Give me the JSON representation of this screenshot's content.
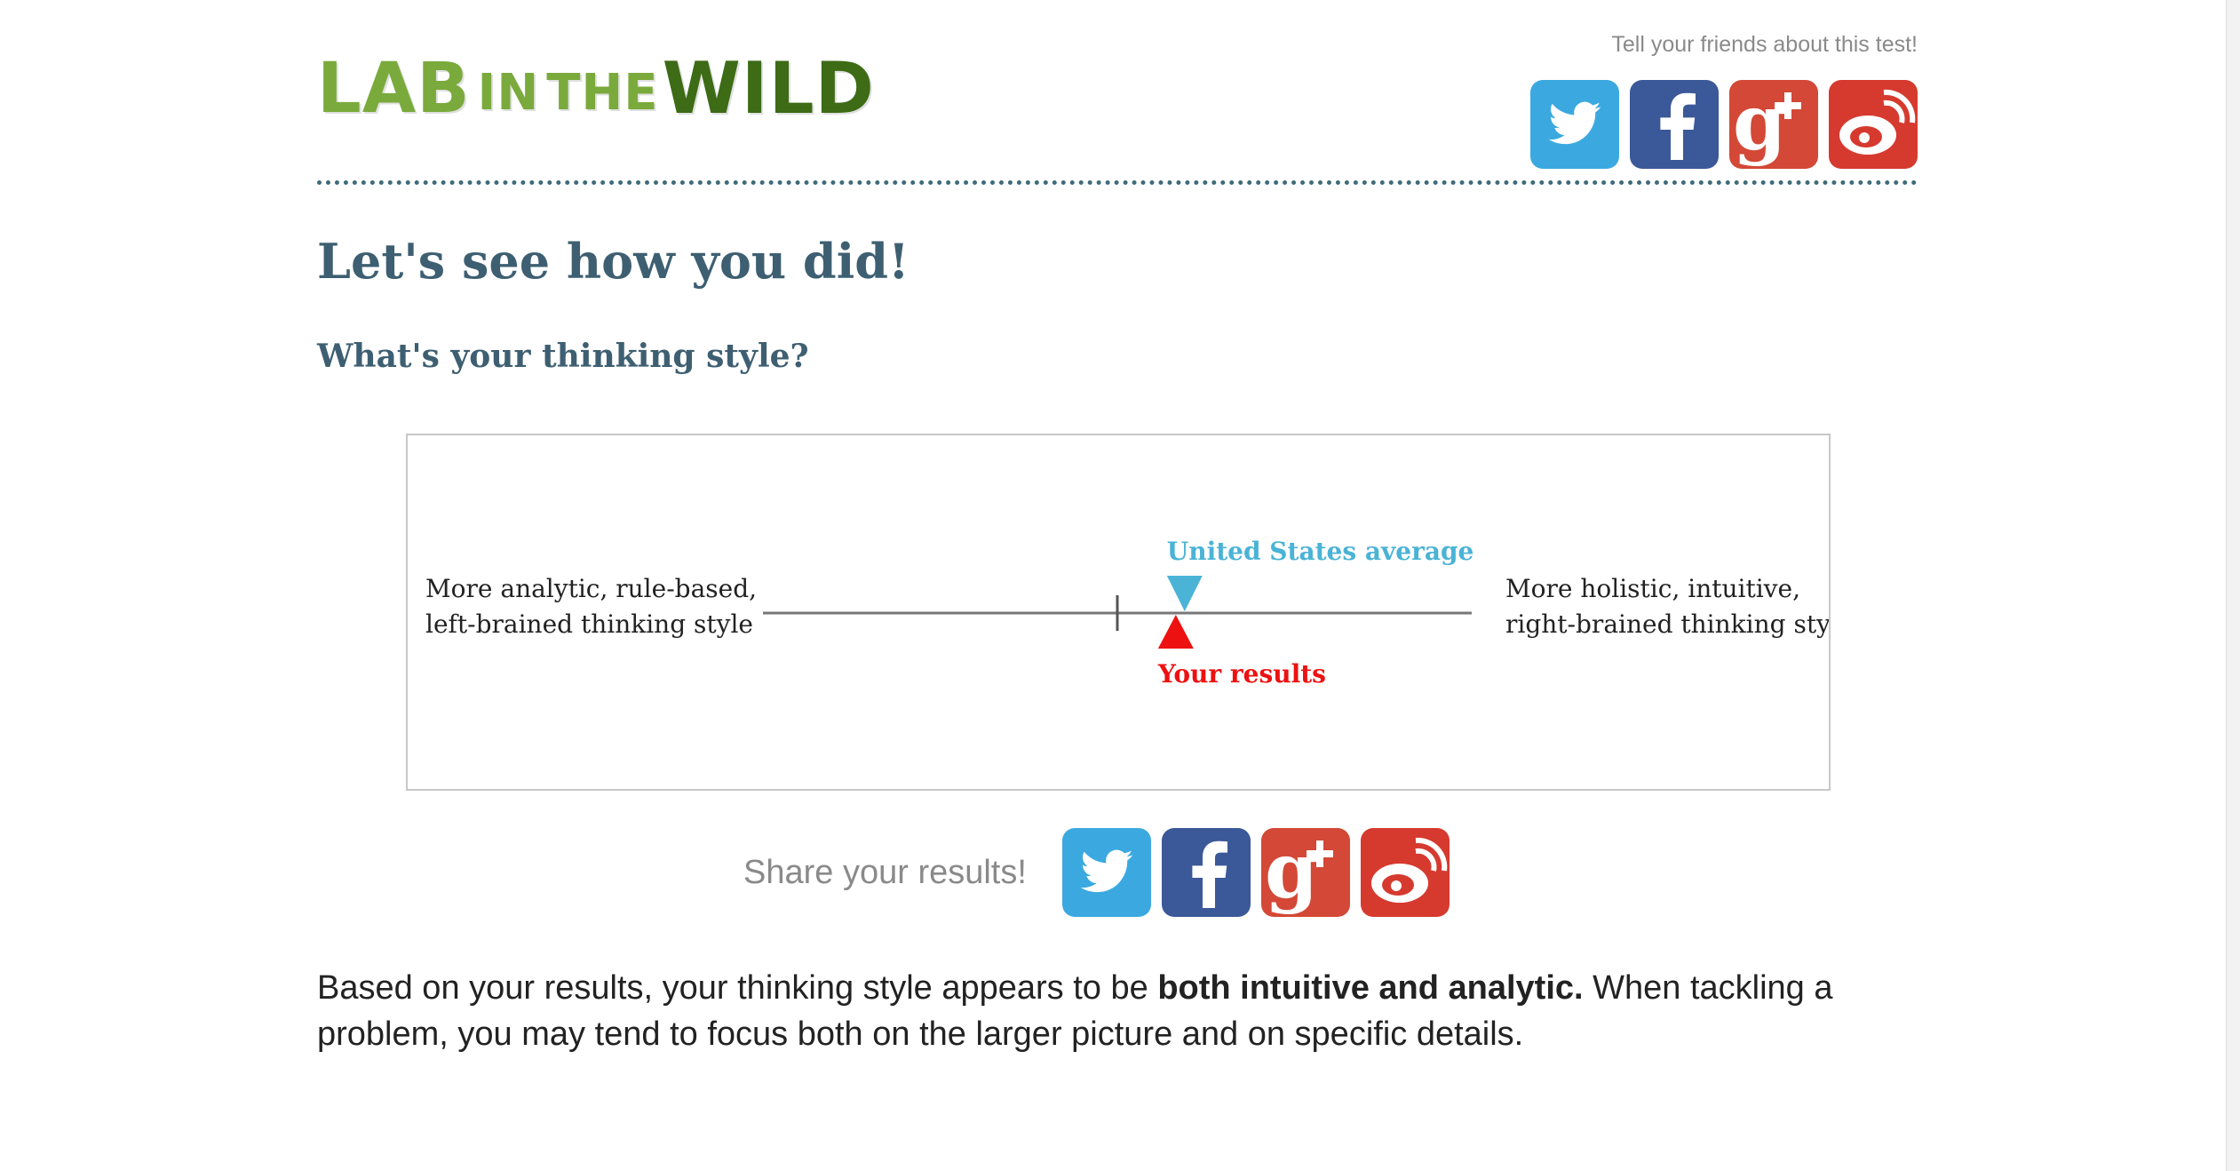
{
  "header": {
    "logo": {
      "lab": "LAB",
      "in": "IN",
      "the": "THE",
      "wild": "WILD"
    },
    "tell_friends": "Tell your friends about this test!",
    "share_icons": [
      "twitter-icon",
      "facebook-icon",
      "google-plus-icon",
      "weibo-icon"
    ]
  },
  "main": {
    "title": "Let's see how you did!",
    "subtitle": "What's your thinking style?",
    "share_label": "Share your results!",
    "result": {
      "prefix": "Based on your results, your thinking style appears to be ",
      "bold": "both intuitive and analytic.",
      "suffix": " When tackling a problem, you may tend to focus both on the larger picture and on specific details."
    }
  },
  "colors": {
    "heading": "#3e5f72",
    "twitter": "#3ba9e0",
    "facebook": "#3b5998",
    "google_plus": "#d34836",
    "weibo": "#d63a2f",
    "us_average": "#4ab3d6",
    "your_result": "#ee1111"
  },
  "chart_data": {
    "type": "scale",
    "left_label": [
      "More analytic, rule-based,",
      "left-brained thinking style"
    ],
    "right_label": [
      "More holistic, intuitive,",
      "right-brained thinking style"
    ],
    "range": [
      -1,
      1
    ],
    "center_tick": 0,
    "markers": [
      {
        "name": "United States average",
        "value": 0.19,
        "color": "#4ab3d6",
        "direction": "down",
        "label_position": "above"
      },
      {
        "name": "Your results",
        "value": 0.165,
        "color": "#ee1111",
        "direction": "up",
        "label_position": "below"
      }
    ]
  }
}
